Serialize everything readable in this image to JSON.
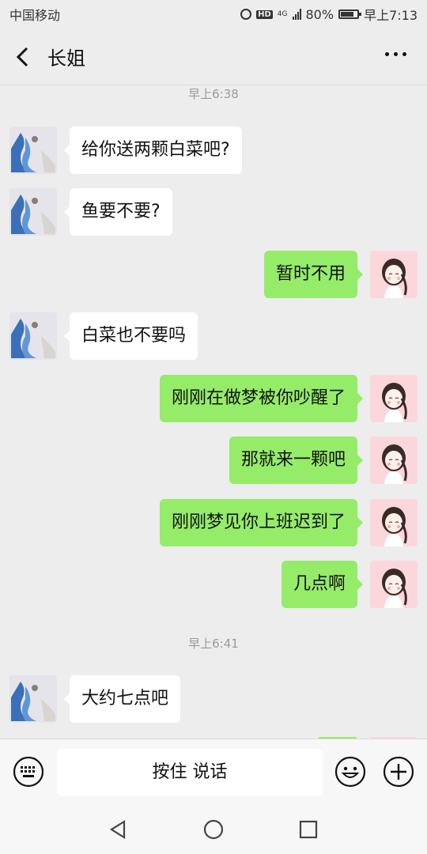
{
  "status_bar": {
    "carrier": "中国移动",
    "hd_label": "HD",
    "network": "4G",
    "battery": "80%",
    "battery_level": 0.8,
    "time": "早上7:13"
  },
  "header": {
    "back_icon": "chevron-left-icon",
    "title": "长姐",
    "more_icon": "more-dots-icon"
  },
  "chat": {
    "timestamps": [
      "早上6:38",
      "早上6:41"
    ],
    "messages": [
      {
        "side": "left",
        "text": "给你送两颗白菜吧?"
      },
      {
        "side": "left",
        "text": "鱼要不要?"
      },
      {
        "side": "right",
        "text": "暂时不用"
      },
      {
        "side": "left",
        "text": "白菜也不要吗"
      },
      {
        "side": "right",
        "text": "刚刚在做梦被你吵醒了"
      },
      {
        "side": "right",
        "text": "那就来一颗吧"
      },
      {
        "side": "right",
        "text": "刚刚梦见你上班迟到了"
      },
      {
        "side": "right",
        "text": "几点啊"
      },
      {
        "side": "left",
        "text": "大约七点吧"
      }
    ]
  },
  "input_bar": {
    "keyboard_icon": "keyboard-icon",
    "voice_label": "按住 说话",
    "emoji_icon": "emoji-icon",
    "plus_icon": "plus-icon"
  },
  "system_nav": {
    "back": "back-triangle-icon",
    "home": "home-circle-icon",
    "recents": "recents-square-icon"
  },
  "colors": {
    "background": "#ededed",
    "sent_bubble": "#95ec69",
    "received_bubble": "#ffffff",
    "timestamp": "#9a9a9a"
  }
}
